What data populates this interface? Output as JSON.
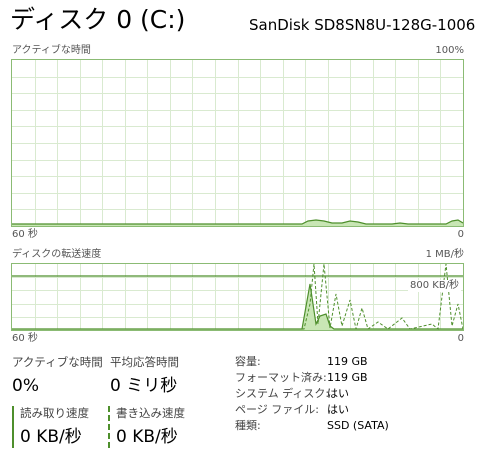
{
  "header": {
    "title": "ディスク 0 (C:)",
    "model": "SanDisk SD8SN8U-128G-1006"
  },
  "active_time_graph": {
    "label": "アクティブな時間",
    "max_label": "100%",
    "time_label": "60 秒",
    "min_label": "0"
  },
  "transfer_graph": {
    "label": "ディスクの転送速度",
    "max_label": "1 MB/秒",
    "ref_label": "800 KB/秒",
    "time_label": "60 秒",
    "min_label": "0"
  },
  "stats": {
    "active_time_label": "アクティブな時間",
    "active_time_value": "0%",
    "response_label": "平均応答時間",
    "response_value": "0 ミリ秒",
    "read_label": "読み取り速度",
    "read_value": "0 KB/秒",
    "write_label": "書き込み速度",
    "write_value": "0 KB/秒"
  },
  "properties": [
    {
      "key": "容量:",
      "value": "119 GB"
    },
    {
      "key": "フォーマット済み:",
      "value": "119 GB"
    },
    {
      "key": "システム ディスク:",
      "value": "はい"
    },
    {
      "key": "ページ ファイル:",
      "value": "はい"
    },
    {
      "key": "種類:",
      "value": "SSD (SATA)"
    }
  ],
  "colors": {
    "accent": "#4e8f2c",
    "grid": "#d9ead0",
    "fill": "#c8e6b4",
    "border": "#8bbb74"
  }
}
